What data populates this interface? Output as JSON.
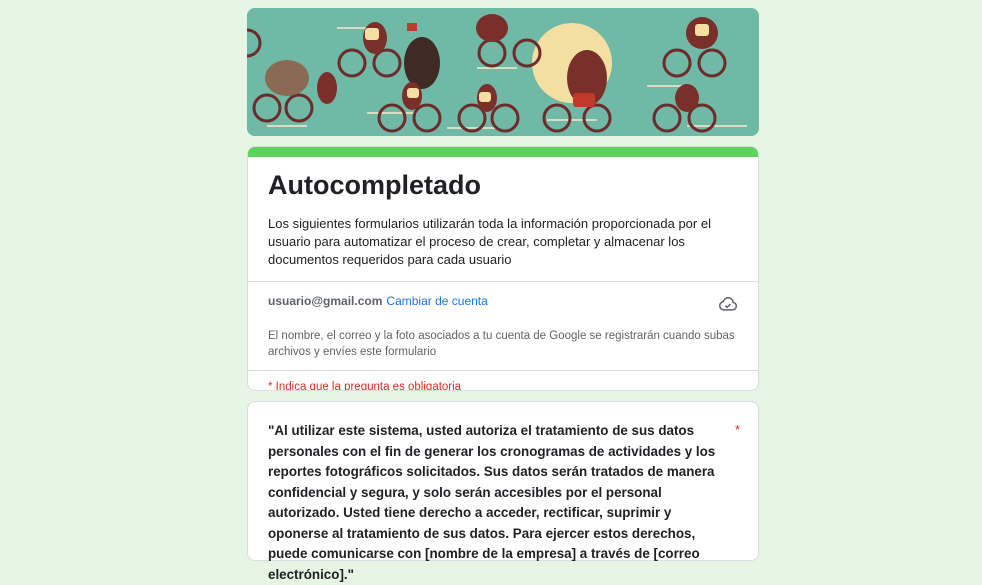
{
  "form": {
    "title": "Autocompletado",
    "description": "Los siguientes formularios utilizarán toda la información proporcionada por el usuario para automatizar el proceso de crear, completar y almacenar los documentos requeridos para cada usuario",
    "account_email": "usuario@gmail.com",
    "switch_account": "Cambiar de cuenta",
    "account_notice": "El nombre, el correo y la foto asociados a tu cuenta de Google se registrarán cuando subas archivos y envíes este formulario",
    "required_note": "* Indica que la pregunta es obligatoria"
  },
  "question": {
    "text": " \"Al utilizar este sistema, usted autoriza el tratamiento de sus datos personales con el fin de generar los cronogramas de actividades y los reportes fotográficos solicitados. Sus datos serán tratados de manera confidencial y segura, y solo serán accesibles por el personal autorizado. Usted tiene derecho a acceder, rectificar, suprimir y oponerse al tratamiento de sus datos. Para ejercer estos derechos, puede comunicarse con [nombre de la empresa] a través de [correo electrónico].\"",
    "required_mark": "*"
  },
  "icons": {
    "cloud": "cloud-sync-icon"
  },
  "colors": {
    "background": "#e6f5e4",
    "accent": "#5cd35c",
    "link": "#1a73e8",
    "required": "#d93025"
  }
}
